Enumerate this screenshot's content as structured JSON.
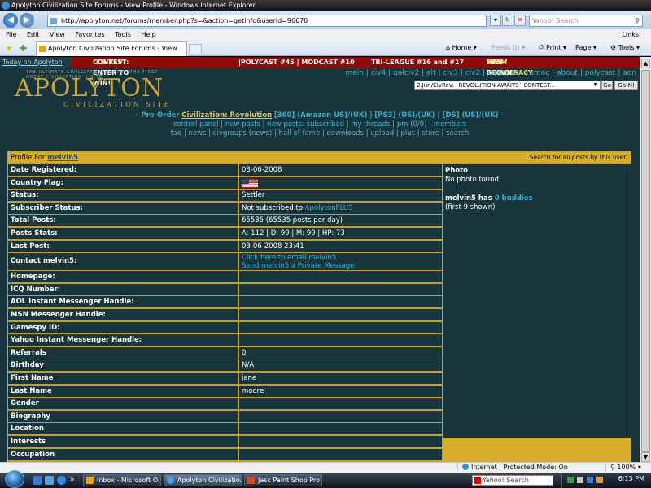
{
  "window": {
    "title": "Apolyton Civilization Site Forums - View Profile - Windows Internet Explorer"
  },
  "addressbar": {
    "url": "http://apolyton.net/forums/member.php?s=&action=getinfo&userid=96670",
    "search_placeholder": "Yahoo! Search"
  },
  "menubar": {
    "items": [
      "File",
      "Edit",
      "View",
      "Favorites",
      "Tools",
      "Help"
    ],
    "links": "Links"
  },
  "tabbar": {
    "tab_title": "Apolyton Civilization Site Forums - View Profile",
    "home": "Home",
    "feeds": "Feeds (J)",
    "print": "Print",
    "page": "Page",
    "tools": "Tools"
  },
  "strip": {
    "today": "Today on Apolyton",
    "civrev_a": "\"CIVREV\"",
    "civrev_b": "CONTEST: ENTER TO WIN!",
    "polycast": "|POLYCAST #45 | MODCAST #10",
    "trileague": "TRI-LEAGUE #16 and #17",
    "bts_a": "\"BTS\"",
    "bts_b": "TEAM DEMOCRACY GAME",
    "bts_c": "HAS BEGUN"
  },
  "logo": {
    "tagline": "THE ULTIMATE CIVILIZATION II SITE",
    "tagline2": "THE FIRST GREAT CIVILIZATION II SITE",
    "name": "APOLYTON",
    "sub": "CIVILIZATION SITE"
  },
  "topnav": {
    "items": [
      "main",
      "civ4",
      "galciv2",
      "alt",
      "civ3",
      "civ2",
      "ctp2",
      "ron",
      "smac",
      "about",
      "polycast",
      "aon"
    ],
    "select_value": "2.Jun/CivRev: `REVOLUTION AWAITS` CONTEST...",
    "go": "Go",
    "gon": "Go(N)"
  },
  "centerlinks": {
    "preorder": "- Pre-Order",
    "game": "Civilization: Revolution",
    "line1_rest": "[360] (Amazon US)/(UK) | [PS3] (US)/(UK) | [DS] (US)/(UK) -",
    "line2": "control panel | new posts | new posts: subscribed | my threads | pm (0/0) | members",
    "line3": "faq | news | civgroups (news) | hall of fame | downloads | upload | plus | store | search"
  },
  "profile": {
    "header_prefix": "Profile For",
    "username": "melvin5",
    "search_posts": "Search for all posts by this user.",
    "rows": [
      {
        "label": "Date Registered:",
        "value": "03-06-2008"
      },
      {
        "label": "Country Flag:",
        "value": ""
      },
      {
        "label": "Status:",
        "value": "Settler"
      },
      {
        "label": "Subscriber Status:",
        "value": "Not subscribed to",
        "link": "ApolytonPLUS"
      },
      {
        "label": "Total Posts:",
        "value": "65535 (65535 posts per day)"
      },
      {
        "label": "Posts Stats:",
        "value": "A: 112 | D: 99 | M: 99 | HP: 73"
      },
      {
        "label": "Last Post:",
        "value": "03-06-2008 23:41"
      },
      {
        "label": "Contact melvin5:",
        "value": "",
        "link": "Click here to email melvin5",
        "link2": "Send melvin5 a Private Message!"
      },
      {
        "label": "Homepage:",
        "value": ""
      },
      {
        "label": "ICQ Number:",
        "value": ""
      },
      {
        "label": "AOL Instant Messenger Handle:",
        "value": ""
      },
      {
        "label": "MSN Messenger Handle:",
        "value": ""
      },
      {
        "label": "Gamespy ID:",
        "value": ""
      },
      {
        "label": "Yahoo Instant Messenger Handle:",
        "value": ""
      },
      {
        "label": "Referrals",
        "value": "0"
      },
      {
        "label": "Birthday",
        "value": "N/A"
      },
      {
        "label": "First Name",
        "value": "jane"
      },
      {
        "label": "Last Name",
        "value": "moore"
      },
      {
        "label": "Gender",
        "value": ""
      },
      {
        "label": "Biography",
        "value": ""
      },
      {
        "label": "Location",
        "value": ""
      },
      {
        "label": "Interests",
        "value": ""
      },
      {
        "label": "Occupation",
        "value": ""
      }
    ],
    "photo_title": "Photo",
    "photo_none": "No photo found",
    "buddies_prefix": "melvin5 has",
    "buddies_link": "0 buddies",
    "buddies_shown": "(first 9 shown)"
  },
  "statusbar": {
    "zone": "Internet | Protected Mode: On",
    "zoom": "100%"
  },
  "taskbar": {
    "tasks": [
      "Inbox - Microsoft O...",
      "Apolyton Civilizatio...",
      "Jasc Paint Shop Pro ..."
    ],
    "search": "Yahoo! Search",
    "clock": "6:13 PM"
  },
  "colors": {
    "page_bg": "#17353a",
    "gold": "#d8ad2c",
    "link": "#2fb3d8",
    "banner_red": "#8c0a0a"
  }
}
